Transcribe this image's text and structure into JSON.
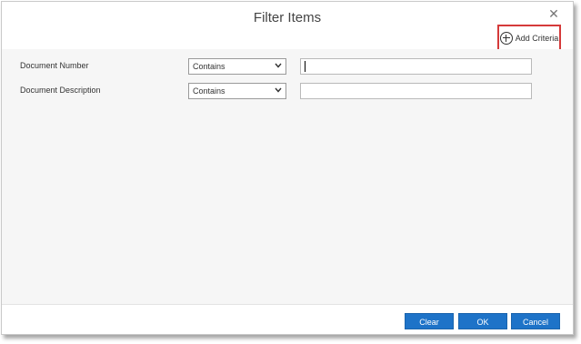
{
  "dialog": {
    "title": "Filter Items",
    "close_icon": "close-icon",
    "add_criteria_label": "Add Criteria",
    "add_criteria_icon": "plus-circle-icon",
    "highlight_color": "#d53a3a"
  },
  "filters": [
    {
      "label": "Document Number",
      "operator": "Contains",
      "value": ""
    },
    {
      "label": "Document Description",
      "operator": "Contains",
      "value": ""
    }
  ],
  "footer": {
    "clear_label": "Clear",
    "ok_label": "OK",
    "cancel_label": "Cancel",
    "button_color": "#1e73c8"
  }
}
